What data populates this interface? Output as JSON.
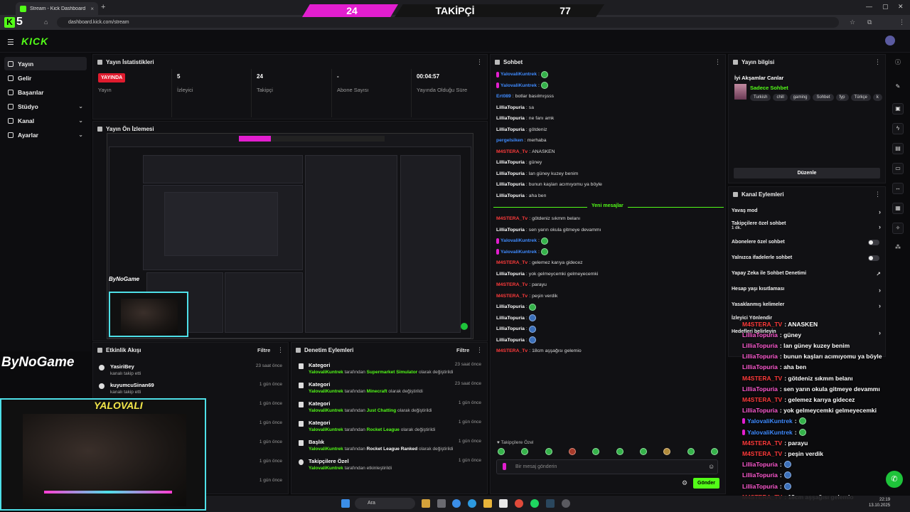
{
  "browser": {
    "tab_title": "Stream - Kick Dashboard",
    "url": "dashboard.kick.com/stream",
    "new_tab": "+",
    "close_tab": "×"
  },
  "overlay_banner": {
    "left_count": "24",
    "label": "TAKİPÇİ",
    "right_count": "77"
  },
  "overlay_badge": {
    "k": "K",
    "number": "5"
  },
  "app": {
    "logo": "KICK"
  },
  "sidebar": {
    "items": [
      {
        "label": "Yayın",
        "active": true,
        "chevron": false
      },
      {
        "label": "Gelir",
        "chevron": false
      },
      {
        "label": "Başarılar",
        "chevron": false
      },
      {
        "label": "Stüdyo",
        "chevron": true
      },
      {
        "label": "Kanal",
        "chevron": true
      },
      {
        "label": "Ayarlar",
        "chevron": true
      }
    ]
  },
  "stats": {
    "title": "Yayın İstatistikleri",
    "live_badge": "YAYINDA",
    "live_label": "Yayın",
    "viewers_value": "5",
    "viewers_label": "İzleyici",
    "followers_value": "24",
    "followers_label": "Takipçi",
    "subs_value": "-",
    "subs_label": "Abone Sayısı",
    "uptime_value": "00:04:57",
    "uptime_label": "Yayında Olduğu Süre"
  },
  "preview": {
    "title": "Yayın Ön İzlemesi",
    "logo": "ByNoGame",
    "cam_text": "YALOVALI"
  },
  "activity": {
    "title": "Etkinlik Akışı",
    "filter": "Filtre",
    "rows": [
      {
        "name": "YasiriBey",
        "sub": "kanalı takip etti",
        "time": "23 saat önce"
      },
      {
        "name": "kuyumcuSinan69",
        "sub": "kanalı takip etti",
        "time": "1 gün önce"
      },
      {
        "name": "",
        "sub": "",
        "time": "1 gün önce"
      },
      {
        "name": "",
        "sub": "",
        "time": "1 gün önce"
      },
      {
        "name": "",
        "sub": "",
        "time": "1 gün önce"
      },
      {
        "name": "",
        "sub": "",
        "time": "1 gün önce"
      },
      {
        "name": "",
        "sub": "",
        "time": "1 gün önce"
      }
    ]
  },
  "moderation": {
    "title": "Denetim Eylemleri",
    "filter": "Filtre",
    "rows": [
      {
        "title": "Kategori",
        "user": "YalovaliKuntrek",
        "mid": " tarafından ",
        "target": "Supermarket Simulator",
        "end": " olarak değiştirildi",
        "time": "23 saat önce"
      },
      {
        "title": "Kategori",
        "user": "YalovaliKuntrek",
        "mid": " tarafından ",
        "target": "Minecraft",
        "end": " olarak değiştirildi",
        "time": "23 saat önce"
      },
      {
        "title": "Kategori",
        "user": "YalovaliKuntrek",
        "mid": " tarafından ",
        "target": "Just Chatting",
        "end": " olarak değiştirildi",
        "time": "1 gün önce"
      },
      {
        "title": "Kategori",
        "user": "YalovaliKuntrek",
        "mid": " tarafından ",
        "target": "Rocket League",
        "end": " olarak değiştirildi",
        "time": "1 gün önce"
      },
      {
        "title": "Başlık",
        "user": "YalovaliKuntrek",
        "mid": " tarafından ",
        "target": "Rocket League Ranked",
        "end": " olarak değiştirildi",
        "time": "1 gün önce"
      },
      {
        "title": "Takipçilere Özel",
        "user": "YalovaliKuntrek",
        "mid": " tarafından etkinleştirildi",
        "target": "",
        "end": "",
        "time": "1 gün önce"
      }
    ]
  },
  "chat": {
    "title": "Sohbet",
    "new_messages": "Yeni mesajlar",
    "followers_only": "Takipçilere Özel",
    "input_placeholder": "Bir mesaj gönderin",
    "send": "Gönder",
    "messages": [
      {
        "user": "YalovaliKuntrek",
        "color": "#3f8bff",
        "text": "",
        "emote": "green",
        "badge": true
      },
      {
        "user": "YalovaliKuntrek",
        "color": "#3f8bff",
        "text": "",
        "emote": "green",
        "badge": true
      },
      {
        "user": "Ert089",
        "color": "#3f8bff",
        "text": "botlar basılmışsss"
      },
      {
        "user": "LilliaTopuria",
        "color": "#ffffff",
        "text": "sa"
      },
      {
        "user": "LilliaTopuria",
        "color": "#ffffff",
        "text": "ne fanı amk"
      },
      {
        "user": "LilliaTopuria",
        "color": "#ffffff",
        "text": "götdeniz"
      },
      {
        "user": "pergelsiken",
        "color": "#3f8bff",
        "text": "merhaba"
      },
      {
        "user": "M4STERA_Tv",
        "color": "#ff3b3b",
        "text": "ANASKEN"
      },
      {
        "user": "LilliaTopuria",
        "color": "#ffffff",
        "text": "güney"
      },
      {
        "user": "LilliaTopuria",
        "color": "#ffffff",
        "text": "lan güney kuzey benim"
      },
      {
        "user": "LilliaTopuria",
        "color": "#ffffff",
        "text": "bunun kaşları acımıyomu ya böyle"
      },
      {
        "user": "LilliaTopuria",
        "color": "#ffffff",
        "text": "aha ben"
      }
    ],
    "new_block": [
      {
        "user": "M4STERA_Tv",
        "color": "#ff3b3b",
        "text": "götdeniz sıkmm belanı"
      },
      {
        "user": "LilliaTopuria",
        "color": "#ffffff",
        "text": "sen yarın okula gitmeye devammı"
      },
      {
        "user": "YalovaliKuntrek",
        "color": "#3f8bff",
        "text": "",
        "emote": "green",
        "badge": true
      },
      {
        "user": "YalovaliKuntrek",
        "color": "#3f8bff",
        "text": "",
        "emote": "green",
        "badge": true
      },
      {
        "user": "M4STERA_Tv",
        "color": "#ff3b3b",
        "text": "gelemez karıya gidecez"
      },
      {
        "user": "LilliaTopuria",
        "color": "#ffffff",
        "text": "yok gelmeycemki gelmeyecemki"
      },
      {
        "user": "M4STERA_Tv",
        "color": "#ff3b3b",
        "text": "parayu"
      },
      {
        "user": "M4STERA_Tv",
        "color": "#ff3b3b",
        "text": "peşin verdik"
      },
      {
        "user": "LilliaTopuria",
        "color": "#ffffff",
        "text": "",
        "emote": "green"
      },
      {
        "user": "LilliaTopuria",
        "color": "#ffffff",
        "text": "",
        "emote": "blue"
      },
      {
        "user": "LilliaTopuria",
        "color": "#ffffff",
        "text": "",
        "emote": "blue"
      },
      {
        "user": "LilliaTopuria",
        "color": "#ffffff",
        "text": "",
        "emote": "blue"
      },
      {
        "user": "M4STERA_Tv",
        "color": "#ff3b3b",
        "text": "18cm aşşağısı gelemio"
      }
    ]
  },
  "stream_info": {
    "title": "Yayın bilgisi",
    "stream_title": "İyi Akşamlar Canlar",
    "category": "Sadece Sohbet",
    "tags": [
      "Turkish",
      "chill",
      "gaming",
      "Sohbet",
      "fyp",
      "Türkçe",
      "k"
    ],
    "edit": "Düzenle"
  },
  "channel_actions": {
    "title": "Kanal Eylemleri",
    "items": [
      {
        "label": "Yavaş mod",
        "sub": "",
        "control": "chevron"
      },
      {
        "label": "Takipçilere özel sohbet",
        "sub": "1 dk.",
        "control": "chevron"
      },
      {
        "label": "Abonelere özel sohbet",
        "sub": "",
        "control": "toggle"
      },
      {
        "label": "Yalnızca ifadelerle sohbet",
        "sub": "",
        "control": "toggle"
      },
      {
        "label": "Yapay Zeka ile Sohbet Denetimi",
        "sub": "",
        "control": "ext"
      },
      {
        "label": "Hesap yaşı kısıtlaması",
        "sub": "",
        "control": "chevron"
      },
      {
        "label": "Yasaklanmış kelimeler",
        "sub": "",
        "control": "chevron"
      },
      {
        "label": "İzleyici Yönlendir",
        "sub": "",
        "control": "none"
      },
      {
        "label": "Hedefleri belirleyin",
        "sub": "",
        "control": "chevron"
      }
    ]
  },
  "overlay_chat": [
    {
      "user": "M4STERA_TV",
      "color": "#ff3b3b",
      "text": ": ANASKEN"
    },
    {
      "user": "LilliaTopuria",
      "color": "#ff5ad1",
      "text": ": güney"
    },
    {
      "user": "LilliaTopuria",
      "color": "#ff5ad1",
      "text": ": lan güney kuzey benim"
    },
    {
      "user": "LilliaTopuria",
      "color": "#ff5ad1",
      "text": ": bunun kaşları acımıyomu ya böyle"
    },
    {
      "user": "LilliaTopuria",
      "color": "#ff5ad1",
      "text": ": aha ben"
    },
    {
      "user": "M4STERA_TV",
      "color": "#ff3b3b",
      "text": ": götdeniz sıkmm belanı"
    },
    {
      "user": "LilliaTopuria",
      "color": "#ff5ad1",
      "text": ": sen yarın okula gitmeye devammı"
    },
    {
      "user": "M4STERA_TV",
      "color": "#ff3b3b",
      "text": ": gelemez karıya gidecez"
    },
    {
      "user": "LilliaTopuria",
      "color": "#ff5ad1",
      "text": ": yok gelmeycemki gelmeyecemki"
    },
    {
      "user": "YalovaliKuntrek",
      "color": "#3f8bff",
      "text": ":",
      "emote": "green"
    },
    {
      "user": "YalovaliKuntrek",
      "color": "#3f8bff",
      "text": ":",
      "emote": "green"
    },
    {
      "user": "M4STERA_TV",
      "color": "#ff3b3b",
      "text": ": parayu"
    },
    {
      "user": "M4STERA_TV",
      "color": "#ff3b3b",
      "text": ": peşin verdik"
    },
    {
      "user": "LilliaTopuria",
      "color": "#ff5ad1",
      "text": ":",
      "emote": "blue"
    },
    {
      "user": "LilliaTopuria",
      "color": "#ff5ad1",
      "text": ":",
      "emote": "blue"
    },
    {
      "user": "LilliaTopuria",
      "color": "#ff5ad1",
      "text": ":",
      "emote": "blue"
    },
    {
      "user": "M4STERA_TV",
      "color": "#ff3b3b",
      "text": ": 18cm aşşağısı gelemio"
    }
  ],
  "taskbar": {
    "search": "Ara",
    "time": "22:19",
    "date": "13.10.2025"
  },
  "colors": {
    "accent": "#53fc18",
    "live": "#e01b2e",
    "banner_pink": "#e21ecf"
  }
}
